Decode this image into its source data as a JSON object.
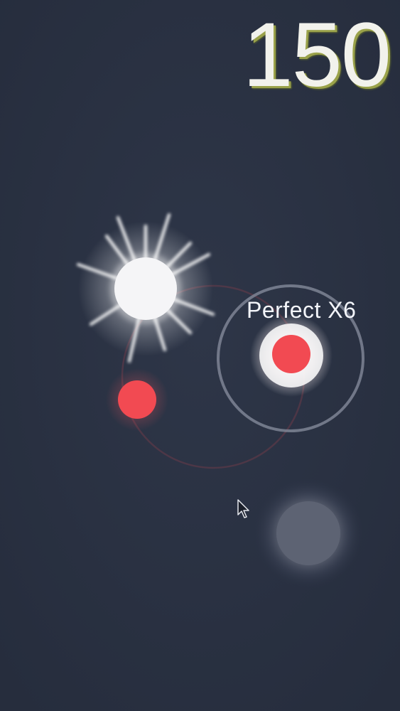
{
  "hud": {
    "score": "150",
    "combo_text": "Perfect X6"
  },
  "colors": {
    "background": "#2a3244",
    "red_ball": "#f24a52",
    "white_ball": "#f5f5f7",
    "ring": "#7d8494",
    "track": "#5a3844",
    "score_shadow": "#9aa24a"
  },
  "icons": {
    "cursor": "mouse-pointer-icon"
  }
}
